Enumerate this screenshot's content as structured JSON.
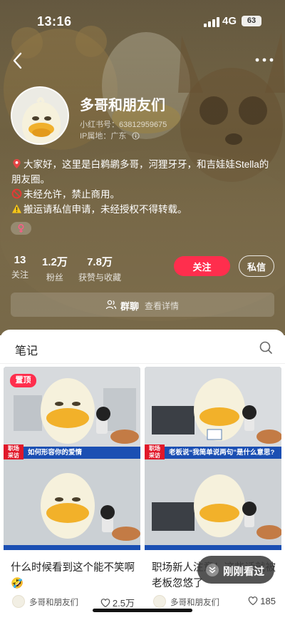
{
  "status_bar": {
    "time": "13:16",
    "network": "4G",
    "battery": "63"
  },
  "profile": {
    "nickname": "多哥和朋友们",
    "xhs_id": "小红书号：63812959675",
    "ip_location": "IP属地：广东",
    "bio_lines": [
      "大家好，这里是白鹈鹕多哥，河狸牙牙，和吉娃娃Stella的朋友圈。",
      "未经允许，禁止商用。",
      "搬运请私信申请，未经授权不得转载。"
    ],
    "gender": "female"
  },
  "stats": [
    {
      "value": "13",
      "label": "关注"
    },
    {
      "value": "1.2万",
      "label": "粉丝"
    },
    {
      "value": "7.8万",
      "label": "获赞与收藏"
    }
  ],
  "actions": {
    "follow": "关注",
    "message": "私信"
  },
  "group": {
    "name": "群聊",
    "detail": "查看详情"
  },
  "notes_tab": "笔记",
  "notes": [
    {
      "pinned": "置顶",
      "news_tag_top": "职场",
      "news_tag_bottom": "采访",
      "news_caption": "如何形容你的爱情",
      "title": "什么时候看到这个能不笑啊🤣",
      "author": "多哥和朋友们",
      "likes": "2.5万"
    },
    {
      "news_tag_top": "职场",
      "news_tag_bottom": "采访",
      "news_caption": "老板说“我简单说两句”是什么意思?",
      "title": "职场新人注意！这些话就被老板忽悠了",
      "author": "多哥和朋友们",
      "likes": "185"
    }
  ],
  "float_button": "刚刚看过",
  "colors": {
    "accent": "#ff2e4d",
    "banner": "#8a7a55",
    "news_blue": "#1b4fb3",
    "news_red": "#e0182a"
  }
}
